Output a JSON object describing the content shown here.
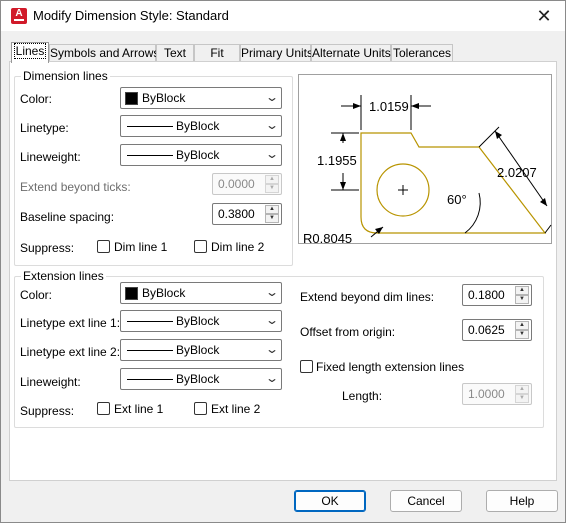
{
  "window": {
    "title": "Modify Dimension Style: Standard",
    "close": "✕",
    "icon_letter": "A"
  },
  "tabs": [
    {
      "label": "Lines",
      "active": true
    },
    {
      "label": "Symbols and Arrows"
    },
    {
      "label": "Text"
    },
    {
      "label": "Fit"
    },
    {
      "label": "Primary Units"
    },
    {
      "label": "Alternate Units"
    },
    {
      "label": "Tolerances"
    }
  ],
  "dimension_lines": {
    "legend": "Dimension lines",
    "color_label": "Color:",
    "color_value": "ByBlock",
    "linetype_label": "Linetype:",
    "linetype_value": "ByBlock",
    "lineweight_label": "Lineweight:",
    "lineweight_value": "ByBlock",
    "extend_label": "Extend beyond ticks:",
    "extend_value": "0.0000",
    "baseline_label": "Baseline spacing:",
    "baseline_value": "0.3800",
    "suppress_label": "Suppress:",
    "dim_line_1": "Dim line 1",
    "dim_line_2": "Dim line 2"
  },
  "extension_lines": {
    "legend": "Extension lines",
    "color_label": "Color:",
    "color_value": "ByBlock",
    "linetype1_label": "Linetype ext line 1:",
    "linetype1_value": "ByBlock",
    "linetype2_label": "Linetype ext line 2:",
    "linetype2_value": "ByBlock",
    "lineweight_label": "Lineweight:",
    "lineweight_value": "ByBlock",
    "suppress_label": "Suppress:",
    "ext_line_1": "Ext line 1",
    "ext_line_2": "Ext line 2",
    "extend_beyond_label": "Extend beyond dim lines:",
    "extend_beyond_value": "0.1800",
    "offset_label": "Offset from origin:",
    "offset_value": "0.0625",
    "fixed_length_label": "Fixed length extension lines",
    "length_label": "Length:",
    "length_value": "1.0000"
  },
  "preview": {
    "dim_top": "1.0159",
    "dim_left": "1.1955",
    "dim_right": "2.0207",
    "angle": "60°",
    "radius": "R0.8045",
    "shape_color": "#b89400"
  },
  "buttons": {
    "ok": "OK",
    "cancel": "Cancel",
    "help": "Help"
  }
}
